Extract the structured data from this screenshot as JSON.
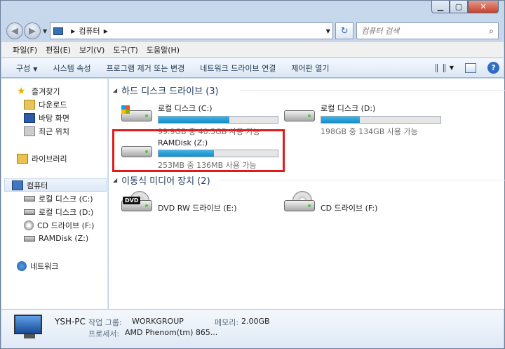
{
  "window": {
    "caption": {
      "min": "▁",
      "max": "▢",
      "close": "✕"
    }
  },
  "nav": {
    "back": "◀",
    "forward": "▶",
    "address_sep": "▶",
    "address_current": "컴퓨터",
    "address_sep2": "▶",
    "refresh": "↻",
    "search_placeholder": "컴퓨터 검색",
    "search_icon": "⌕"
  },
  "menubar": [
    "파일(F)",
    "편집(E)",
    "보기(V)",
    "도구(T)",
    "도움말(H)"
  ],
  "cmdbar": {
    "organize": "구성",
    "items": [
      "시스템 속성",
      "프로그램 제거 또는 변경",
      "네트워크 드라이브 연결",
      "제어판 열기"
    ],
    "help": "?"
  },
  "navpane": {
    "favorites": "즐겨찾기",
    "downloads": "다운로드",
    "desktop": "바탕 화면",
    "recent": "최근 위치",
    "libraries": "라이브러리",
    "computer": "컴퓨터",
    "drive_c": "로컬 디스크 (C:)",
    "drive_d": "로컬 디스크 (D:)",
    "drive_f": "CD 드라이브 (F:)",
    "drive_z": "RAMDisk (Z:)",
    "network": "네트워크"
  },
  "content": {
    "hdd_group": "하드 디스크 드라이브 (3)",
    "removable_group": "이동식 미디어 장치 (2)",
    "drives": [
      {
        "name": "로컬 디스크 (C:)",
        "free": "99.9GB 중 40.5GB 사용 가능",
        "used_fraction": 0.595
      },
      {
        "name": "로컬 디스크 (D:)",
        "free": "198GB 중 134GB 사용 가능",
        "used_fraction": 0.323
      },
      {
        "name": "RAMDisk (Z:)",
        "free": "253MB 중 136MB 사용 가능",
        "used_fraction": 0.462
      }
    ],
    "removable": [
      {
        "name": "DVD RW 드라이브 (E:)",
        "badge": "DVD"
      },
      {
        "name": "CD 드라이브 (F:)"
      }
    ]
  },
  "details": {
    "pc_name": "YSH-PC",
    "workgroup_label": "작업 그룹:",
    "workgroup": "WORKGROUP",
    "memory_label": "메모리:",
    "memory": "2.00GB",
    "processor_label": "프로세서:",
    "processor": "AMD Phenom(tm) 865..."
  }
}
